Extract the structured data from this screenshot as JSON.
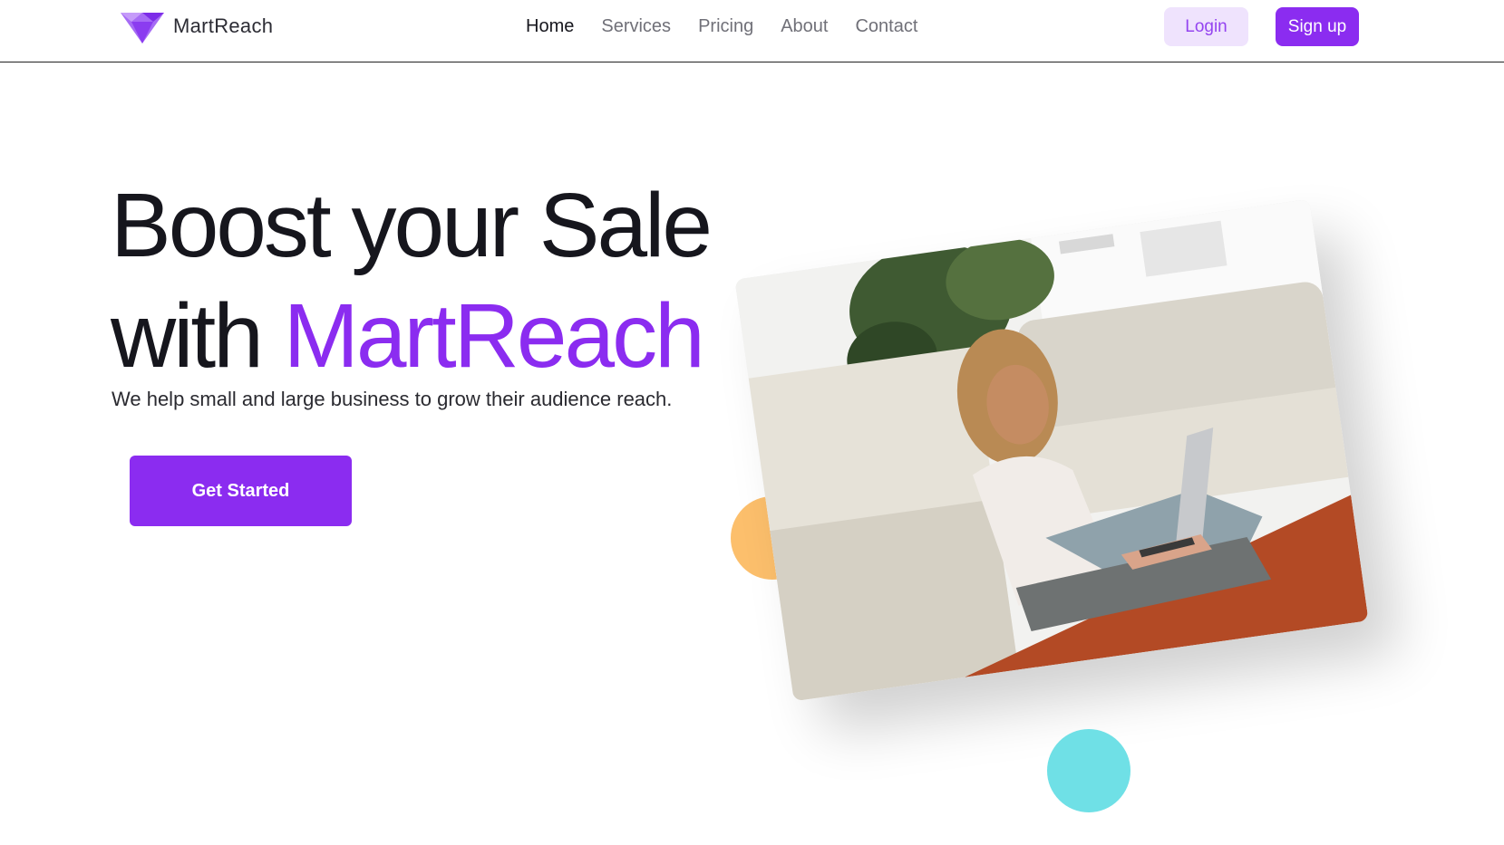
{
  "brand": {
    "name": "MartReach",
    "accent_color": "#8b2cf0",
    "logo_icon": "diamond-logo-icon"
  },
  "nav": {
    "items": [
      {
        "label": "Home",
        "active": true
      },
      {
        "label": "Services",
        "active": false
      },
      {
        "label": "Pricing",
        "active": false
      },
      {
        "label": "About",
        "active": false
      },
      {
        "label": "Contact",
        "active": false
      }
    ]
  },
  "auth": {
    "login_label": "Login",
    "signup_label": "Sign up"
  },
  "hero": {
    "title_line1": "Boost your Sale",
    "title_line2_prefix": "with ",
    "title_line2_accent": "MartReach",
    "subtitle": "We help small and large business to grow their audience reach.",
    "cta_label": "Get Started"
  },
  "decor": {
    "orange_color": "#fcbf6c",
    "teal_color": "#6fe0e6"
  }
}
